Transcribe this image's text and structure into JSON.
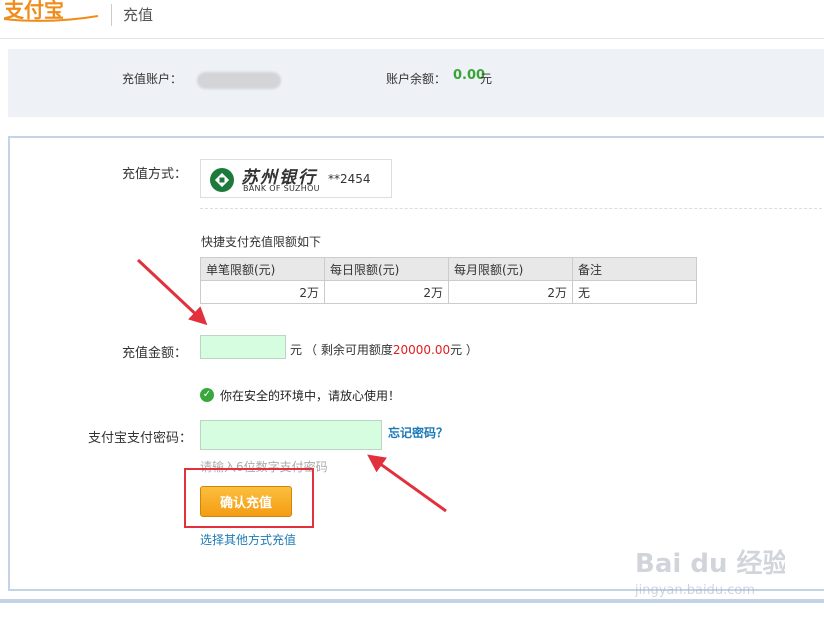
{
  "header": {
    "logo_text": "支付宝",
    "title": "充值"
  },
  "account": {
    "account_label": "充值账户：",
    "balance_label": "账户余额：",
    "balance_value": "0.00",
    "balance_unit": "元"
  },
  "method": {
    "label": "充值方式：",
    "bank_name_cn": "苏州银行",
    "bank_name_en": "BANK OF SUZHOU",
    "card_tail": "**2454"
  },
  "limits": {
    "title": "快捷支付充值限额如下",
    "headers": [
      "单笔限额(元)",
      "每日限额(元)",
      "每月限额(元)",
      "备注"
    ],
    "row": [
      "2万",
      "2万",
      "2万",
      "无"
    ]
  },
  "amount": {
    "label": "充值金额：",
    "value": "",
    "unit": "元",
    "available_prefix": "（ 剩余可用额度",
    "available_value": "20000.00",
    "available_suffix": "元 ）"
  },
  "security": {
    "message": "你在安全的环境中，请放心使用！"
  },
  "password": {
    "label": "支付宝支付密码：",
    "value": "",
    "forgot_link": "忘记密码？",
    "hint": "请输入6位数字支付密码"
  },
  "actions": {
    "confirm_button": "确认充值",
    "other_methods_link": "选择其他方式充值"
  },
  "watermark": {
    "brand": "Bai du 经验",
    "url": "jingyan.baidu.com"
  },
  "colors": {
    "accent_green": "#3aa336",
    "button_orange": "#f49c12",
    "link_blue": "#1c7ab8",
    "highlight_red": "#e02020",
    "annotation_red": "#e0313c"
  }
}
